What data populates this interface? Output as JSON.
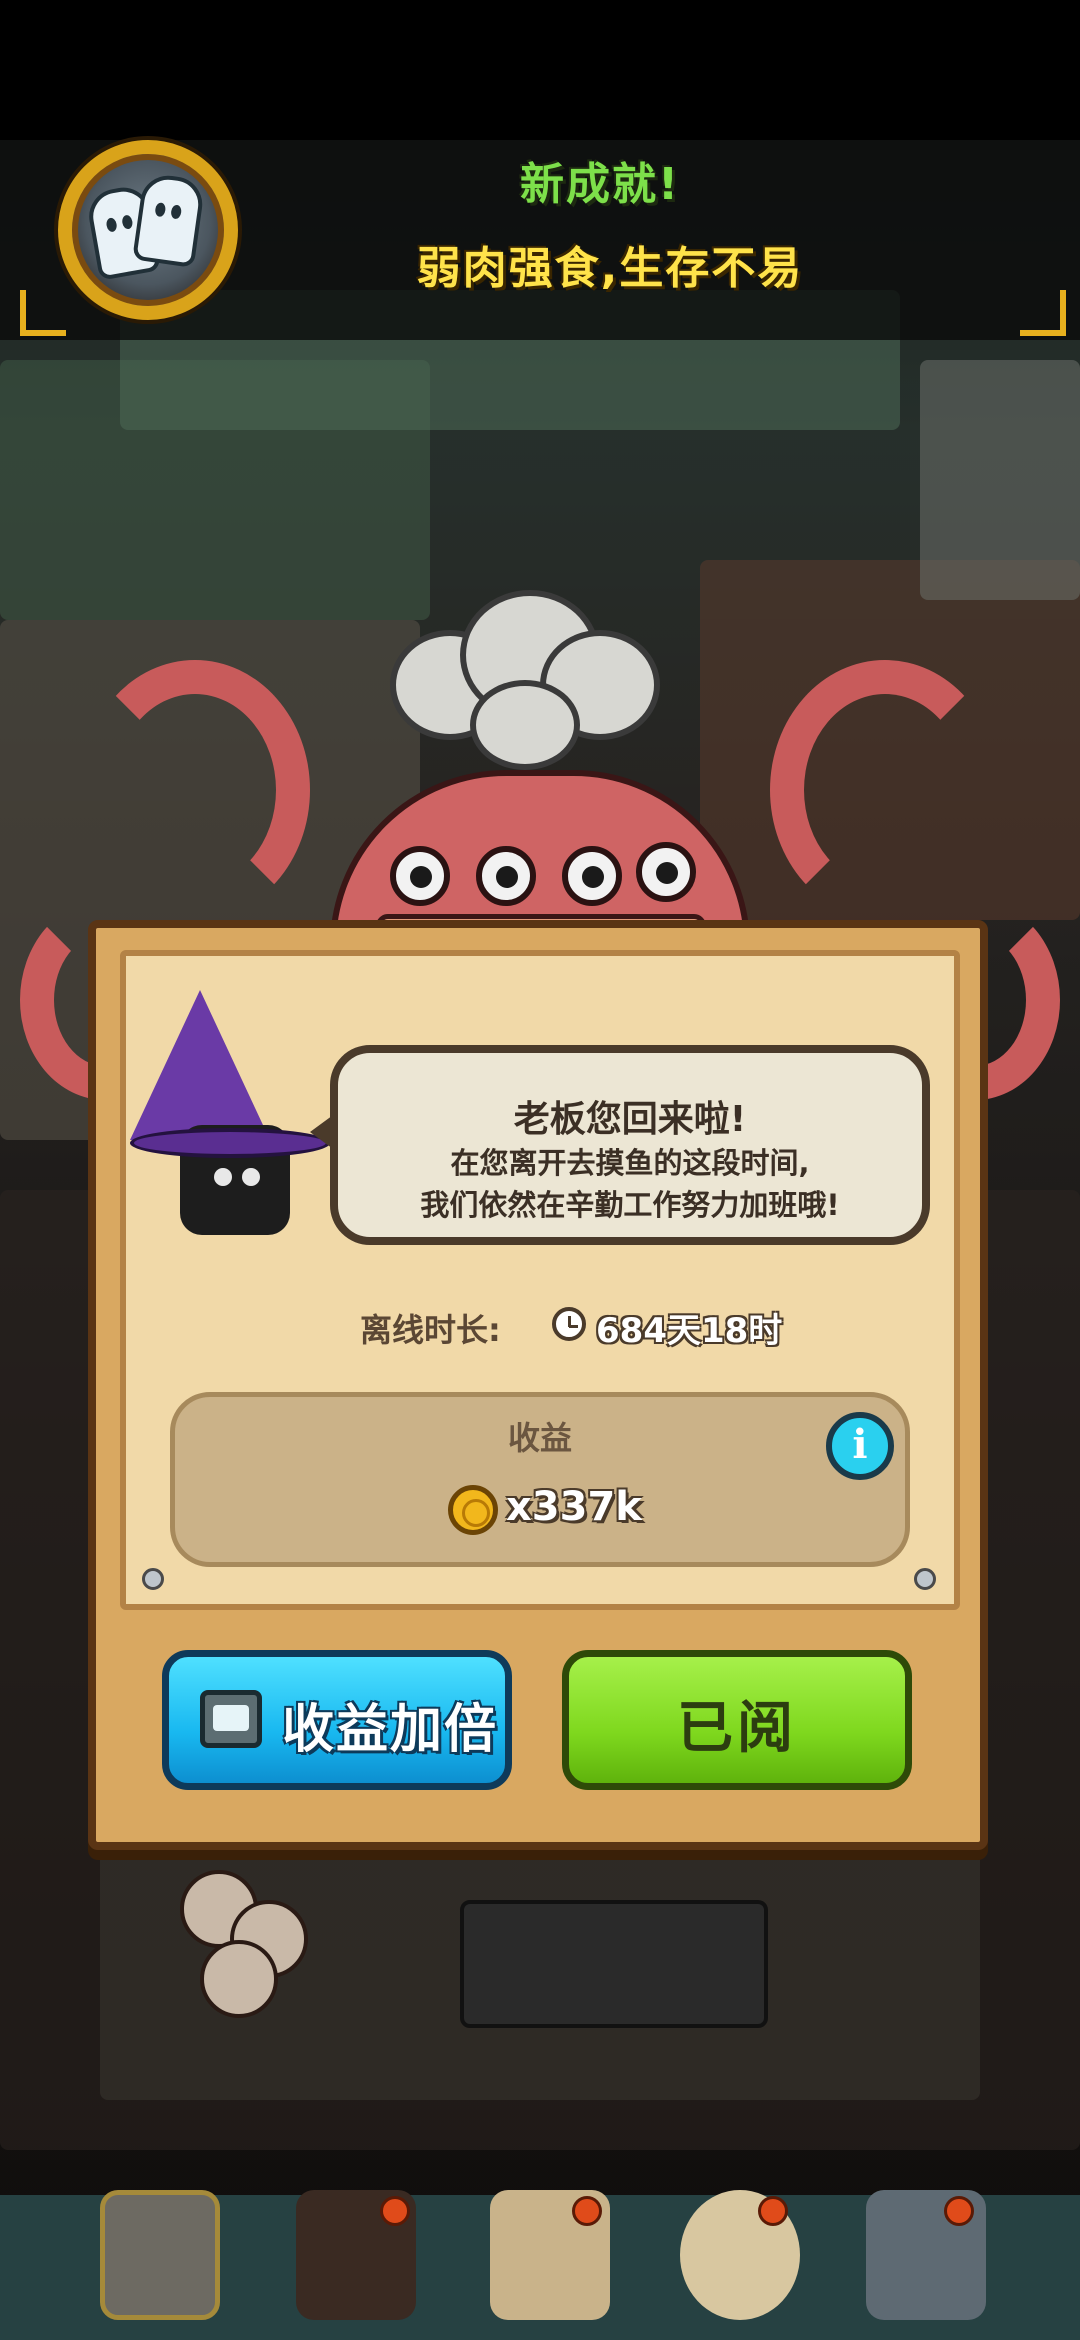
{
  "achievement": {
    "title": "新成就!",
    "name": "弱肉强食,生存不易"
  },
  "dialog": {
    "greeting": "老板您回来啦!",
    "line2": "在您离开去摸鱼的这段时间,",
    "line3": "我们依然在辛勤工作努力加班哦!",
    "offline_label": "离线时长:",
    "offline_value": "684天18时",
    "income_label": "收益",
    "income_value": "x337k",
    "info_label": "i",
    "double_button": "收益加倍",
    "read_button": "已阅"
  },
  "colors": {
    "achievement_title": "#7de04a",
    "achievement_name": "#ffe34a",
    "double_button": "#18b8f0",
    "read_button": "#7fd81e",
    "board": "#d9a861"
  },
  "icons": [
    "ghost-medal-icon",
    "clock-icon",
    "coin-icon",
    "info-icon",
    "tv-icon"
  ],
  "bottom_nav": [
    "kitchen-nav-icon",
    "chest-nav-icon",
    "recipe-book-nav-icon",
    "money-bag-nav-icon",
    "monsters-nav-icon"
  ]
}
